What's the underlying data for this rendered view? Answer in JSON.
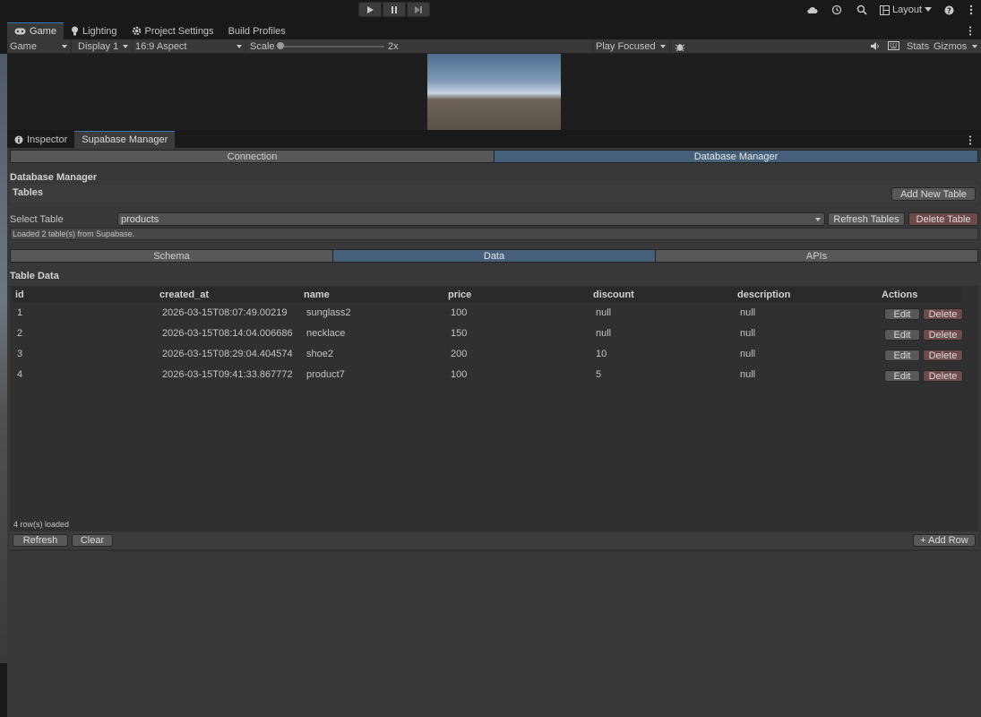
{
  "toolbar": {
    "play_icon": "play-icon",
    "pause_icon": "pause-icon",
    "step_icon": "step-icon",
    "layout_label": "Layout"
  },
  "game_tabs": [
    {
      "label": "Game",
      "icon": "gamepad-icon"
    },
    {
      "label": "Lighting",
      "icon": "lightbulb-icon"
    },
    {
      "label": "Project Settings",
      "icon": "gear-icon"
    },
    {
      "label": "Build Profiles",
      "icon": ""
    }
  ],
  "game_toolbar": {
    "view": "Game",
    "display": "Display 1",
    "aspect": "16:9 Aspect",
    "scale_label": "Scale",
    "scale_value": "2x",
    "play_mode": "Play Focused",
    "stats": "Stats",
    "gizmos": "Gizmos"
  },
  "inspector_tabs": [
    {
      "label": "Inspector",
      "icon": "info-icon"
    },
    {
      "label": "Supabase Manager"
    }
  ],
  "manager": {
    "tabs": [
      "Connection",
      "Database Manager"
    ],
    "active_tab": 1,
    "title": "Database Manager",
    "tables_label": "Tables",
    "add_table": "Add New Table",
    "select_label": "Select Table",
    "selected_table": "products",
    "refresh_tables": "Refresh Tables",
    "delete_table": "Delete Table",
    "status": "Loaded 2 table(s) from Supabase.",
    "sub_tabs": [
      "Schema",
      "Data",
      "APIs"
    ],
    "active_sub_tab": 1,
    "table_data_label": "Table Data"
  },
  "grid": {
    "columns": [
      "id",
      "created_at",
      "name",
      "price",
      "discount",
      "description",
      "Actions"
    ],
    "rows": [
      {
        "id": "1",
        "created_at": "2026-03-15T08:07:49.00219",
        "name": "sunglass2",
        "price": "100",
        "discount": "null",
        "description": "null"
      },
      {
        "id": "2",
        "created_at": "2026-03-15T08:14:04.006686",
        "name": "necklace",
        "price": "150",
        "discount": "null",
        "description": "null"
      },
      {
        "id": "3",
        "created_at": "2026-03-15T08:29:04.404574",
        "name": "shoe2",
        "price": "200",
        "discount": "10",
        "description": "null"
      },
      {
        "id": "4",
        "created_at": "2026-03-15T09:41:33.867772",
        "name": "product7",
        "price": "100",
        "discount": "5",
        "description": "null"
      }
    ],
    "edit_label": "Edit",
    "delete_label": "Delete",
    "row_count": "4 row(s) loaded",
    "refresh": "Refresh",
    "clear": "Clear",
    "add_row": "+ Add Row"
  }
}
